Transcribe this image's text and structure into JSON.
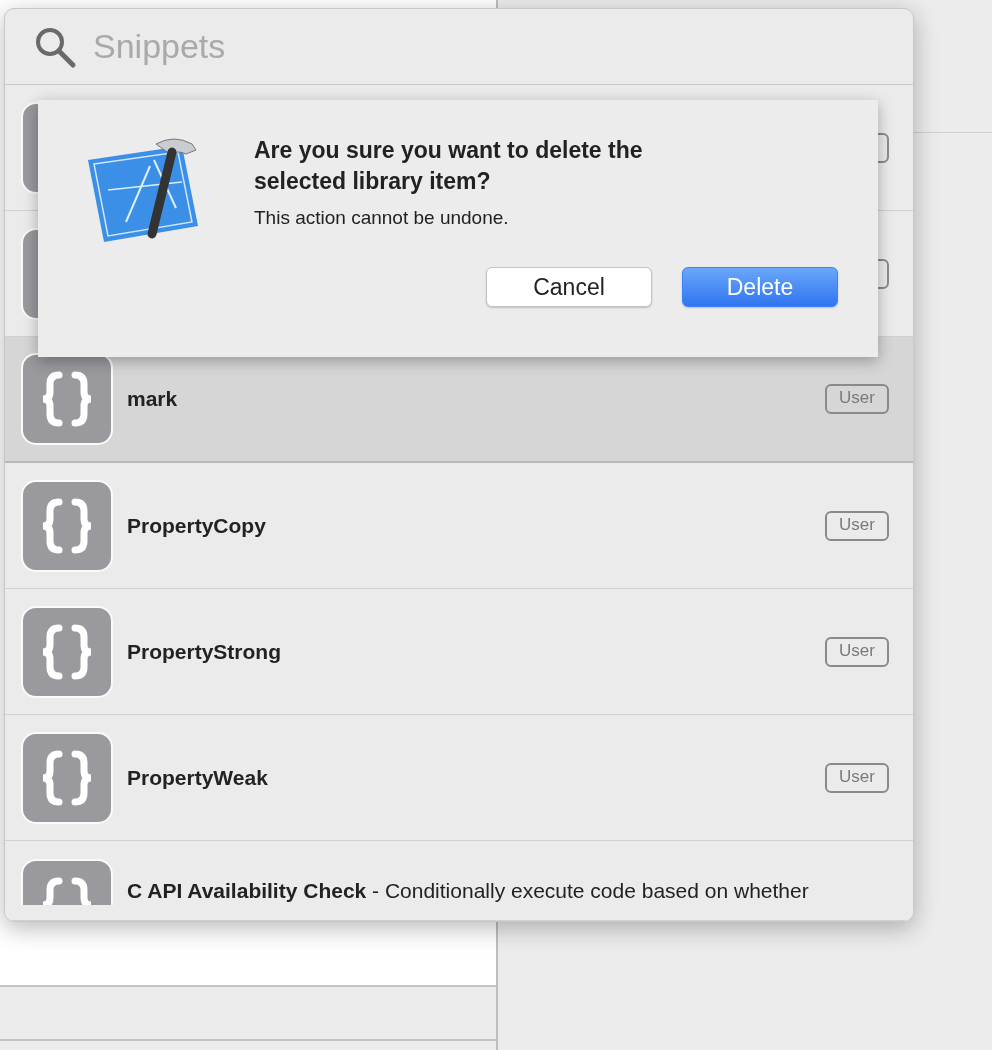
{
  "library": {
    "search": {
      "placeholder": "Snippets"
    },
    "rows": [
      {
        "selected": false
      },
      {
        "selected": false
      },
      {
        "title": "mark",
        "badge": "User",
        "selected": true
      },
      {
        "title": "PropertyCopy",
        "badge": "User",
        "selected": false
      },
      {
        "title": "PropertyStrong",
        "badge": "User",
        "selected": false
      },
      {
        "title": "PropertyWeak",
        "badge": "User",
        "selected": false
      },
      {
        "title": "**C API Availability Check** - Conditionally execute code based on whether",
        "selected": false
      }
    ]
  },
  "alert": {
    "title": "Are you sure you want to delete the selected library item?",
    "message": "This action cannot be undone.",
    "buttons": [
      {
        "label": "Cancel",
        "kind": "secondary"
      },
      {
        "label": "Delete",
        "kind": "primary"
      }
    ]
  }
}
